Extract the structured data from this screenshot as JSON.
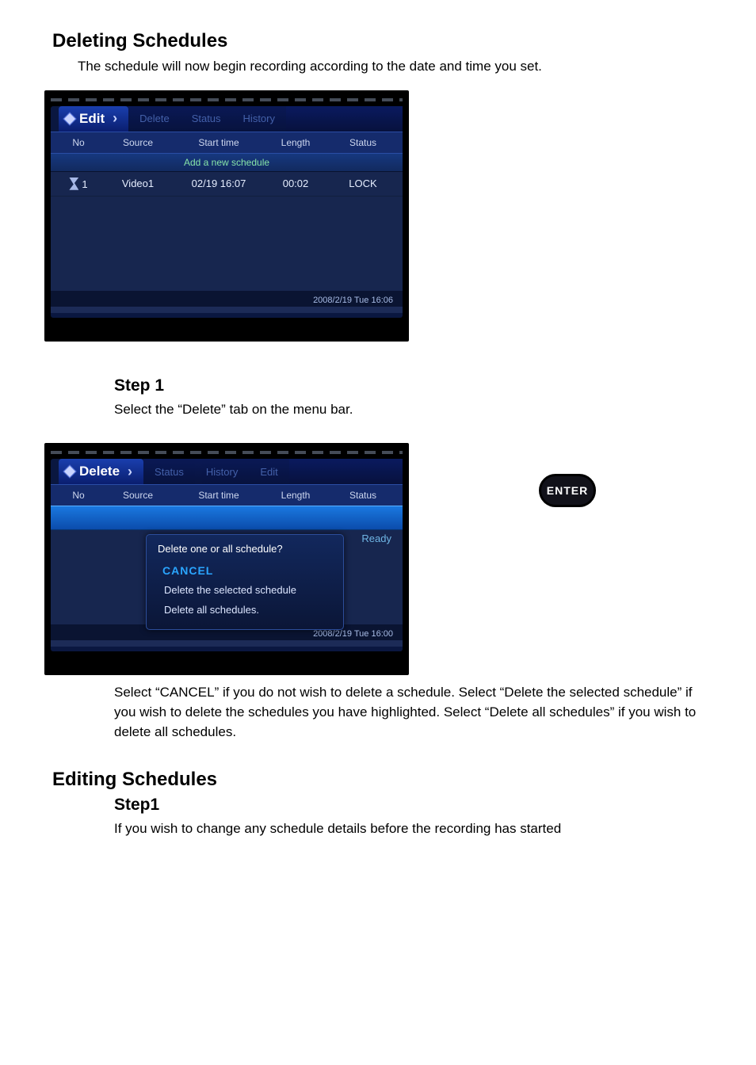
{
  "doc": {
    "title": "Deleting Schedules",
    "subtitle": "The schedule will now begin recording according to the date and time you set."
  },
  "screen1": {
    "active_tab": "Edit",
    "tabs": [
      "Delete",
      "Status",
      "History"
    ],
    "columns": {
      "no": "No",
      "source": "Source",
      "start": "Start time",
      "length": "Length",
      "status": "Status"
    },
    "add_label": "Add a new schedule",
    "row": {
      "no": "1",
      "source": "Video1",
      "start": "02/19 16:07",
      "length": "00:02",
      "status": "LOCK"
    },
    "clock": "2008/2/19 Tue 16:06"
  },
  "step1": {
    "title": "Step 1",
    "desc": "Select the “Delete” tab on the menu bar."
  },
  "enter_label": "ENTER",
  "screen2": {
    "active_tab": "Delete",
    "tabs": [
      "Status",
      "History",
      "Edit"
    ],
    "columns": {
      "no": "No",
      "source": "Source",
      "start": "Start time",
      "length": "Length",
      "status": "Status"
    },
    "dialog_title": "Delete one or all schedule?",
    "cancel": "CANCEL",
    "opt_selected": "Delete the selected schedule",
    "opt_all": "Delete all schedules.",
    "ready": "Ready",
    "clock": "2008/2/19 Tue 16:00"
  },
  "step2": {
    "line1": "Select “CANCEL” if you do not wish to delete a schedule. Select “Delete the selected schedule” if you wish to delete the schedules you have highlighted. Select “Delete all schedules” if you wish to delete all schedules."
  },
  "footer": {
    "heading": "Editing Schedules",
    "sub1": "Step1",
    "sub1_desc": "If you wish to change any schedule details before the recording has started"
  }
}
